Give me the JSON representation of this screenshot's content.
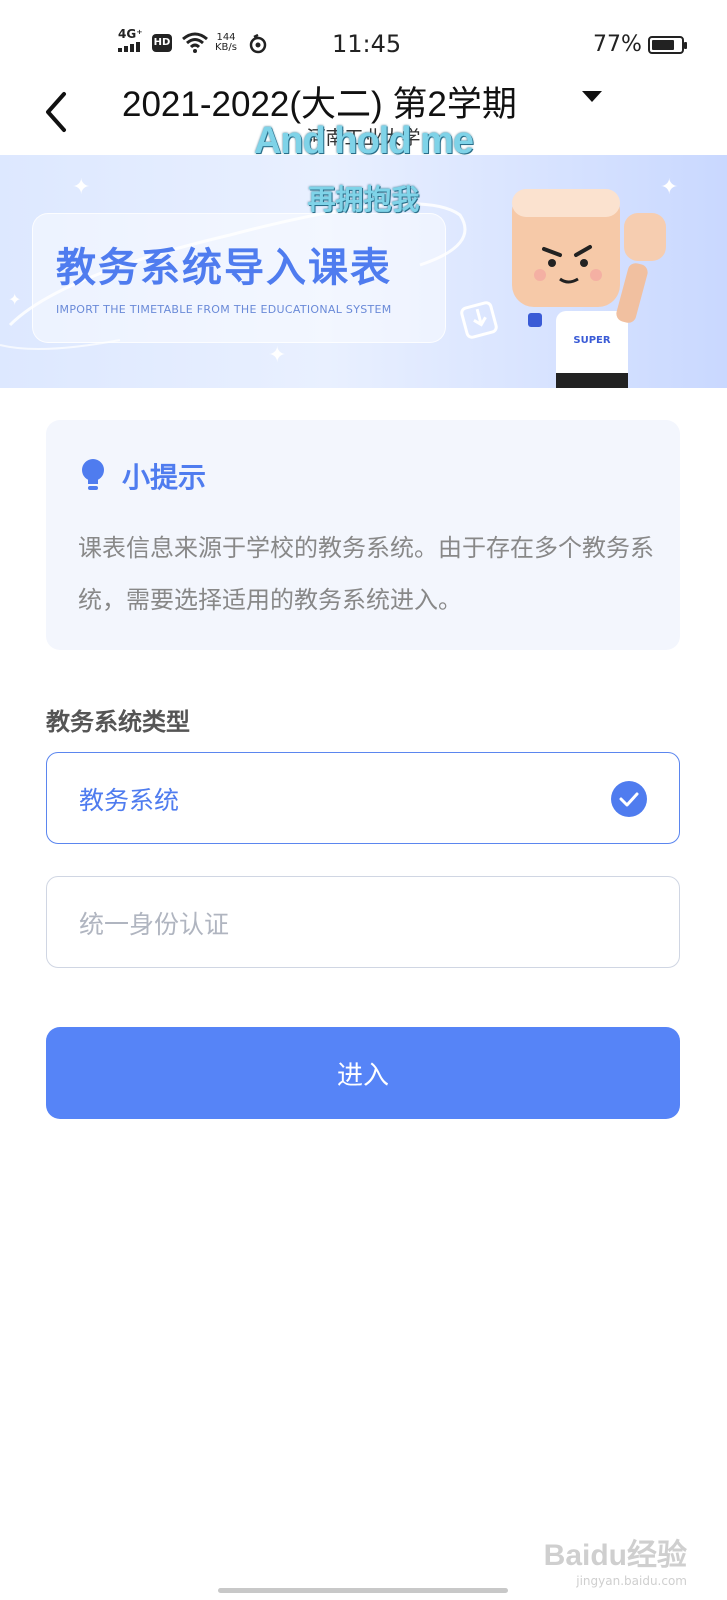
{
  "status_bar": {
    "network": "4G⁺",
    "hd": "HD",
    "speed_value": "144",
    "speed_unit": "KB/s",
    "time": "11:45",
    "battery_text": "77%",
    "battery_level": 0.77
  },
  "header": {
    "term_title": "2021-2022(大二)  第2学期",
    "school_name": "河南工业大学"
  },
  "overlay": {
    "english": "And hold me",
    "chinese": "再拥抱我"
  },
  "banner": {
    "title": "教务系统导入课表",
    "subtitle": "IMPORT THE TIMETABLE FROM THE EDUCATIONAL SYSTEM",
    "mascot_shirt": "SUPER"
  },
  "tip": {
    "title": "小提示",
    "text": "课表信息来源于学校的教务系统。由于存在多个教务系统，需要选择适用的教务系统进入。"
  },
  "form": {
    "section_label": "教务系统类型",
    "options": [
      {
        "label": "教务系统",
        "selected": true
      },
      {
        "label": "统一身份认证",
        "selected": false
      }
    ],
    "submit_label": "进入"
  },
  "watermark": {
    "main": "Baidu经验",
    "sub": "jingyan.baidu.com"
  },
  "colors": {
    "accent": "#4f7cef",
    "button": "#5684f7",
    "tip_bg": "#f3f6fd"
  }
}
